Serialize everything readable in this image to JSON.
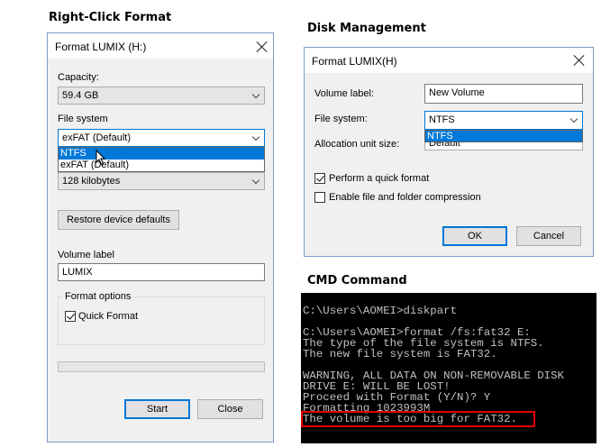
{
  "captions": {
    "right_click": "Right-Click Format",
    "disk_management": "Disk Management",
    "cmd": "CMD Command"
  },
  "left_dialog": {
    "title": "Format LUMIX (H:)",
    "capacity_label": "Capacity:",
    "capacity_value": "59.4 GB",
    "filesystem_label": "File system",
    "filesystem_value": "exFAT (Default)",
    "filesystem_options": [
      "NTFS",
      "exFAT (Default)"
    ],
    "allocation_value": "128 kilobytes",
    "restore_button": "Restore device defaults",
    "volume_label": "Volume label",
    "volume_value": "LUMIX",
    "format_options_label": "Format options",
    "quick_format_label": "Quick Format",
    "quick_format_checked": true,
    "start_button": "Start",
    "close_button": "Close"
  },
  "right_dialog": {
    "title": "Format  LUMIX(H)",
    "volume_label": "Volume label:",
    "volume_value": "New Volume",
    "filesystem_label": "File system:",
    "filesystem_value": "NTFS",
    "filesystem_option": "NTFS",
    "allocation_label": "Allocation unit size:",
    "allocation_value": "Default",
    "quick_format_label": "Perform a quick format",
    "quick_format_checked": true,
    "compression_label": "Enable file and folder compression",
    "compression_checked": false,
    "ok_button": "OK",
    "cancel_button": "Cancel"
  },
  "cmd": {
    "lines": [
      "C:\\Users\\AOMEI>diskpart",
      "",
      "C:\\Users\\AOMEI>format /fs:fat32 E:",
      "The type of the file system is NTFS.",
      "The new file system is FAT32.",
      "",
      "WARNING, ALL DATA ON NON-REMOVABLE DISK",
      "DRIVE E: WILL BE LOST!",
      "Proceed with Format (Y/N)? Y",
      "Formatting 1023993M",
      "The volume is too big for FAT32."
    ],
    "highlight_color": "#e00000"
  }
}
